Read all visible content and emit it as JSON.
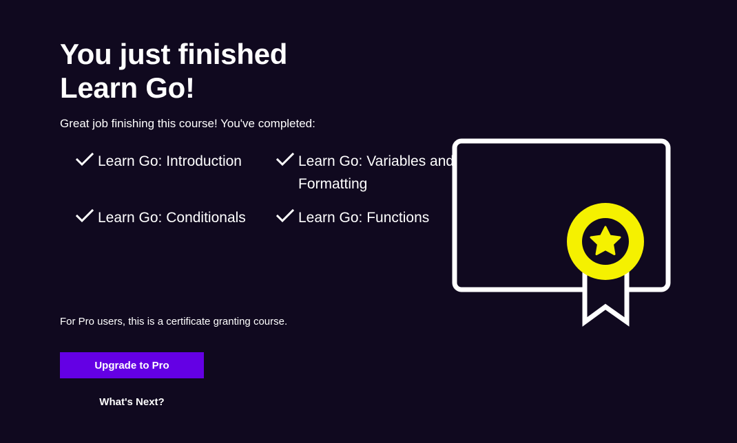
{
  "header": {
    "title_line1": "You just finished",
    "title_line2": "Learn Go!"
  },
  "summary": {
    "intro": "Great job finishing this course! You've completed:",
    "completed_lessons": [
      {
        "label": "Learn Go: Introduction"
      },
      {
        "label": "Learn Go: Variables and Formatting"
      },
      {
        "label": "Learn Go: Conditionals"
      },
      {
        "label": "Learn Go: Functions"
      }
    ]
  },
  "pro": {
    "note": "For Pro users, this is a certificate granting course.",
    "upgrade_label": "Upgrade to Pro",
    "next_label": "What's Next?"
  },
  "colors": {
    "background": "#10091f",
    "accent": "#6400e4",
    "badge": "#f5f100",
    "text": "#ffffff"
  },
  "icons": {
    "check": "check-icon",
    "certificate": "certificate-icon",
    "star": "star-icon"
  }
}
